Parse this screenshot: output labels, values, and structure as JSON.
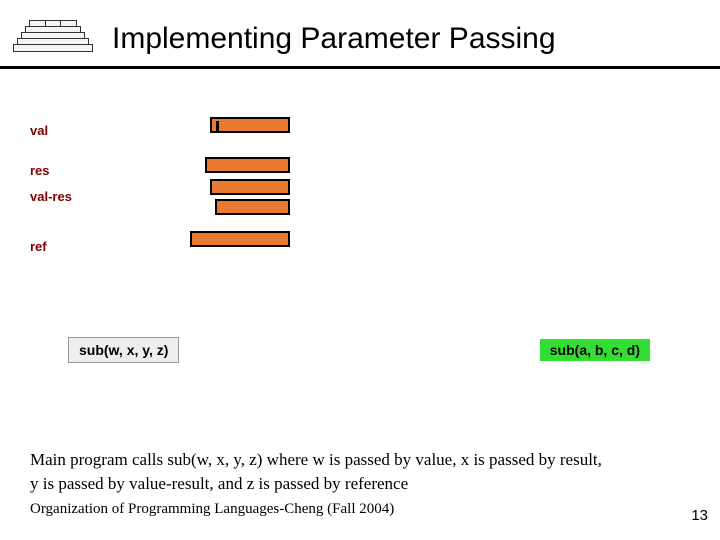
{
  "header": {
    "title": "Implementing Parameter Passing"
  },
  "labels": {
    "val": "val",
    "res": "res",
    "valres": "val-res",
    "ref": "ref"
  },
  "calls": {
    "left": "sub(w, x, y, z)",
    "right": "sub(a, b, c, d)"
  },
  "explanation": {
    "line1": "Main program calls sub(w, x, y, z) where w is passed by value, x is passed by result,",
    "line2": "y is passed by value-result, and z is passed by reference"
  },
  "footer": {
    "text": "Organization of Programming Languages-Cheng (Fall 2004)",
    "page": "13"
  }
}
